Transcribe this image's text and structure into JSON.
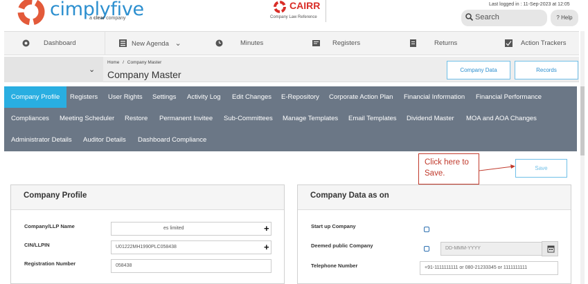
{
  "header": {
    "brand": "cimplyfive",
    "brand_sub_prefix": "a ",
    "brand_sub_bold": "clear",
    "brand_sub_suffix": " company",
    "cairr_title": "CAIRR",
    "cairr_sub": "Company Law Reference",
    "last_logged": "Last logged in : 11-Sep-2023 at 12:05",
    "search_placeholder": "Search",
    "help_label": "Help"
  },
  "mainnav": [
    {
      "label": "Dashboard",
      "icon": "dashboard-icon"
    },
    {
      "label": "New Agenda",
      "icon": "list-icon"
    },
    {
      "label": "Minutes",
      "icon": "clock-icon"
    },
    {
      "label": "Registers",
      "icon": "register-icon"
    },
    {
      "label": "Returns",
      "icon": "document-icon"
    },
    {
      "label": "Action Trackers",
      "icon": "tracker-icon"
    }
  ],
  "breadcrumb": {
    "home": "Home",
    "sep": "/",
    "current": "Company Master",
    "title": "Company Master",
    "company_data_btn": "Company Data",
    "records_btn": "Records"
  },
  "tabs": {
    "row1": [
      "Company Profile",
      "Registers",
      "User Rights",
      "Settings",
      "Activity Log",
      "Edit Changes",
      "E-Repository",
      "Corporate Action Plan",
      "Financial Information",
      "Financial Performance"
    ],
    "row2": [
      "Compliances",
      "Meeting Scheduler",
      "Restore",
      "Permanent Invitee",
      "Sub-Committees",
      "Manage Templates",
      "Email Templates",
      "Dividend Master",
      "MOA and AOA Changes"
    ],
    "row3": [
      "Administrator Details",
      "Auditor Details",
      "Dashboard Compliance"
    ],
    "active": "Company Profile"
  },
  "content": {
    "save_label": "Save",
    "callout_line1": "Click here to",
    "callout_line2": "Save."
  },
  "profile": {
    "title": "Company Profile",
    "name_label": "Company/LLP Name",
    "name_value": "es limited",
    "cin_label": "CIN/LLPIN",
    "cin_value": "U01222MH1990PLC058438",
    "reg_label": "Registration Number",
    "reg_value": "058438"
  },
  "companydata": {
    "title": "Company Data as on",
    "startup_label": "Start up Company",
    "deemed_label": "Deemed public Company",
    "date_placeholder": "DD-MMM-YYYY",
    "phone_label": "Telephone Number",
    "phone_placeholder": "+91-1111111111 or 080-21233345 or 1111111111"
  },
  "colors": {
    "accent": "#29aee1",
    "tabs_bg": "#6b7786",
    "callout": "#c0392b"
  }
}
